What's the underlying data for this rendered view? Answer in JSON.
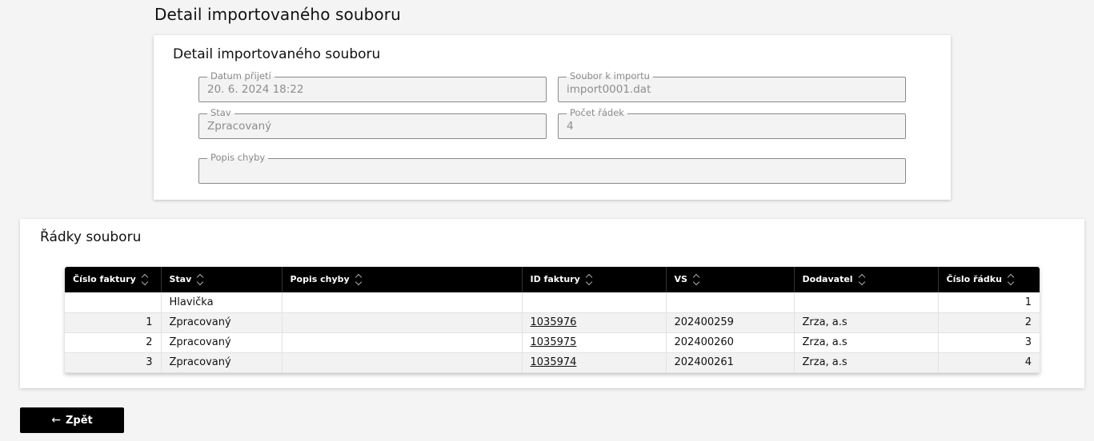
{
  "page_title": "Detail importovaného souboru",
  "detail": {
    "title": "Detail importovaného souboru",
    "fields": [
      {
        "label": "Datum přijetí",
        "value": "20. 6. 2024 18:22"
      },
      {
        "label": "Soubor k importu",
        "value": "import0001.dat"
      },
      {
        "label": "Stav",
        "value": "Zpracovaný"
      },
      {
        "label": "Počet řádek",
        "value": "4"
      },
      {
        "label": "Popis chyby",
        "value": ""
      }
    ]
  },
  "rows_section": {
    "title": "Řádky souboru",
    "columns": [
      "Číslo faktury",
      "Stav",
      "Popis chyby",
      "ID faktury",
      "VS",
      "Dodavatel",
      "Číslo řádku"
    ],
    "rows": [
      {
        "cislo_faktury": "",
        "stav": "Hlavička",
        "popis_chyby": "",
        "id_faktury": "",
        "vs": "",
        "dodavatel": "",
        "cislo_radku": "1"
      },
      {
        "cislo_faktury": "1",
        "stav": "Zpracovaný",
        "popis_chyby": "",
        "id_faktury": "1035976",
        "vs": "202400259",
        "dodavatel": "Zrza, a.s",
        "cislo_radku": "2"
      },
      {
        "cislo_faktury": "2",
        "stav": "Zpracovaný",
        "popis_chyby": "",
        "id_faktury": "1035975",
        "vs": "202400260",
        "dodavatel": "Zrza, a.s",
        "cislo_radku": "3"
      },
      {
        "cislo_faktury": "3",
        "stav": "Zpracovaný",
        "popis_chyby": "",
        "id_faktury": "1035974",
        "vs": "202400261",
        "dodavatel": "Zrza, a.s",
        "cislo_radku": "4"
      }
    ]
  },
  "back_button": {
    "label": "Zpět",
    "icon": "arrow-left-icon"
  }
}
